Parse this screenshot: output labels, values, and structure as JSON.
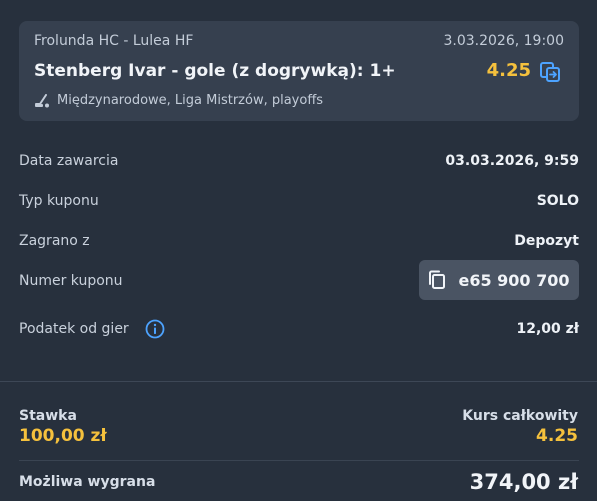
{
  "bet": {
    "match": "Frolunda HC - Lulea HF",
    "event_date": "3.03.2026, 19:00",
    "market": "Stenberg Ivar - gole (z dogrywką): 1+",
    "odds": "4.25",
    "league": "Międzynarodowe, Liga Mistrzów, playoffs",
    "sport_icon": "hockey-stick-icon",
    "copy_icon": "copy-to-slip-icon"
  },
  "details": [
    {
      "label": "Data zawarcia",
      "value": "03.03.2026, 9:59"
    },
    {
      "label": "Typ kuponu",
      "value": "SOLO"
    },
    {
      "label": "Zagrano z",
      "value": "Depozyt"
    },
    {
      "label": "Numer kuponu",
      "value": "e65 900 700"
    },
    {
      "label": "Podatek od gier",
      "value": "12,00 zł"
    }
  ],
  "summary": {
    "stake_label": "Stawka",
    "stake_value": "100,00 zł",
    "total_odds_label": "Kurs całkowity",
    "total_odds_value": "4.25",
    "win_label": "Możliwa wygrana",
    "win_value": "374,00 zł"
  },
  "colors": {
    "background": "#27303d",
    "card": "#36404f",
    "accent": "#f5c13d",
    "link_icon": "#4da3ff"
  }
}
